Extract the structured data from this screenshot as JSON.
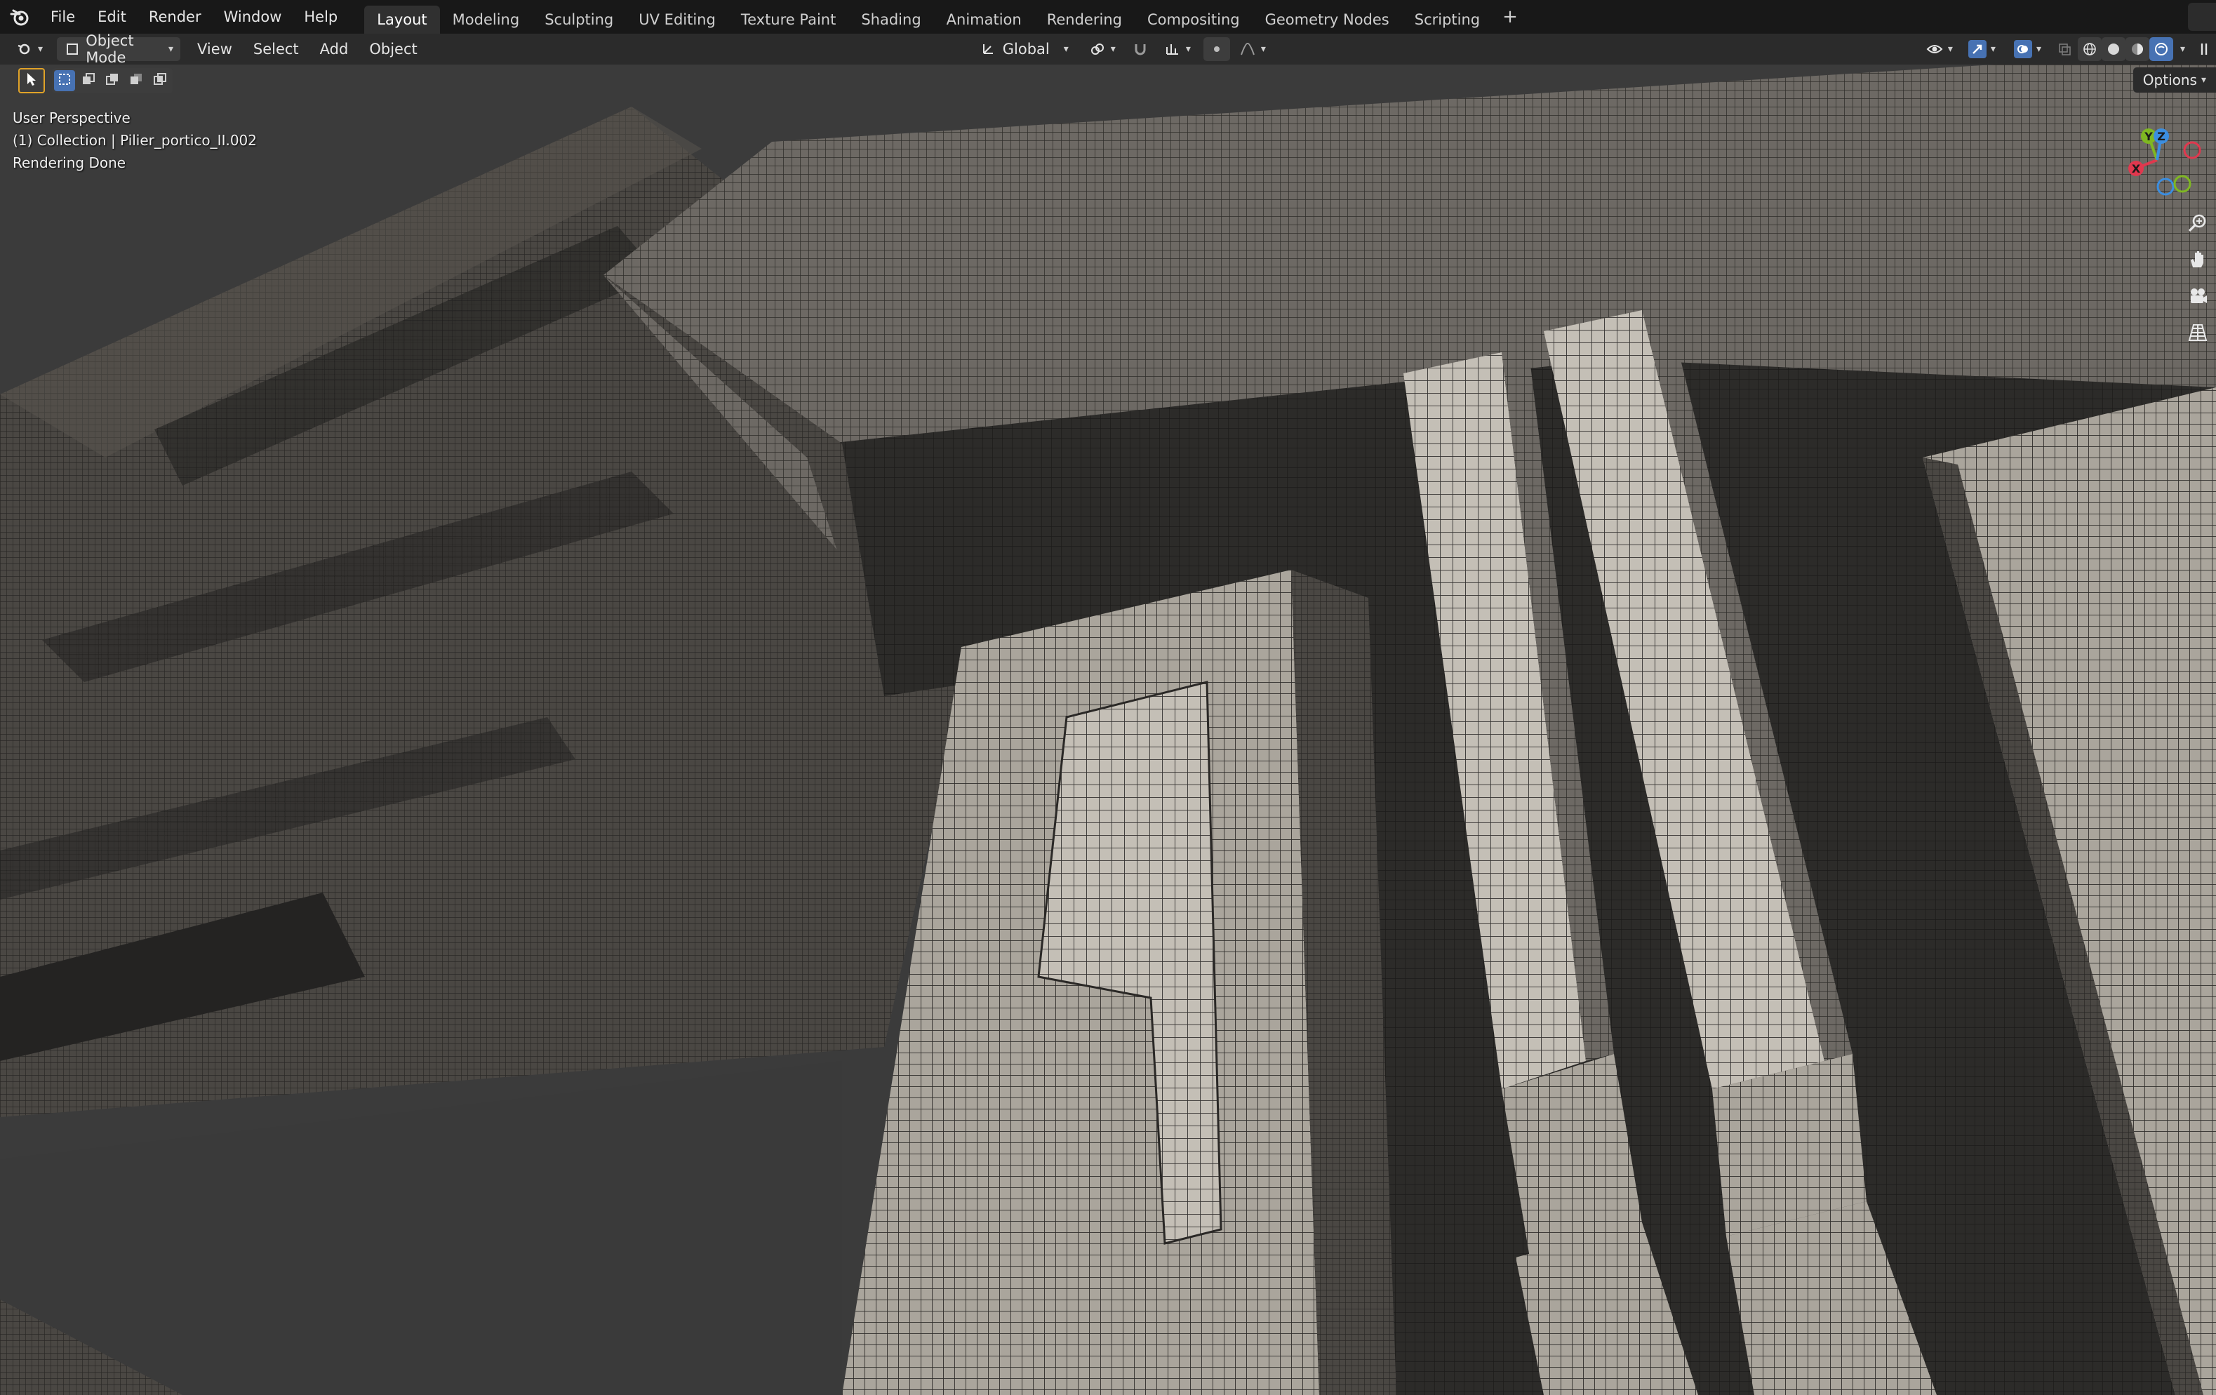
{
  "topbar": {
    "menus": [
      "File",
      "Edit",
      "Render",
      "Window",
      "Help"
    ],
    "workspaces": [
      "Layout",
      "Modeling",
      "Sculpting",
      "UV Editing",
      "Texture Paint",
      "Shading",
      "Animation",
      "Rendering",
      "Compositing",
      "Geometry Nodes",
      "Scripting"
    ],
    "active_workspace": "Layout",
    "add_workspace": "+"
  },
  "header": {
    "mode": "Object Mode",
    "menus": [
      "View",
      "Select",
      "Add",
      "Object"
    ],
    "orientation": "Global"
  },
  "toolrow": {
    "options_label": "Options"
  },
  "overlay": {
    "view_name": "User Perspective",
    "collection_info": "(1) Collection | Pilier_portico_II.002",
    "status": "Rendering Done"
  },
  "gizmo": {
    "x_label": "X",
    "y_label": "Y",
    "z_label": "Z"
  },
  "colors": {
    "accent_blue": "#4772b3",
    "active_tool_outline": "#e0a328",
    "axis_x": "#e0384e",
    "axis_y": "#7fb722",
    "axis_z": "#3b8ee0"
  }
}
